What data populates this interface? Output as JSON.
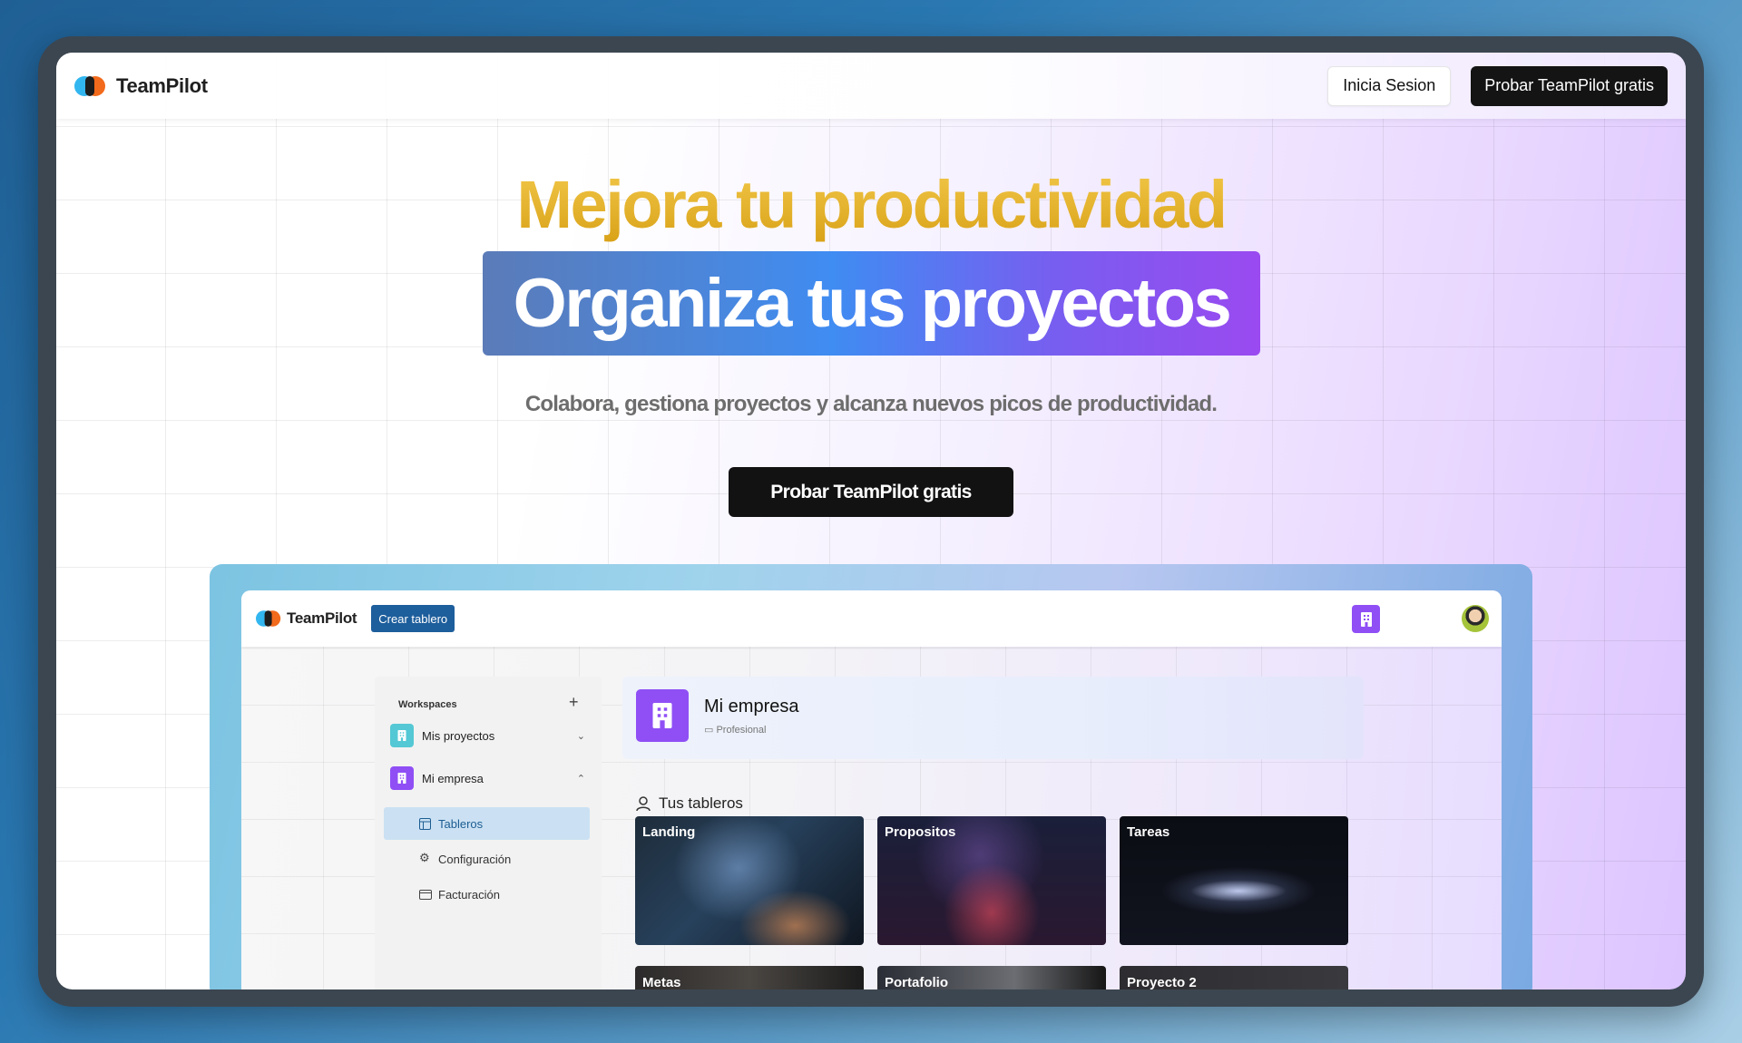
{
  "nav": {
    "brand": "TeamPilot",
    "login_label": "Inicia Sesion",
    "cta_label": "Probar TeamPilot gratis"
  },
  "hero": {
    "title": "Mejora tu productividad",
    "band": "Organiza tus proyectos",
    "subtitle": "Colabora, gestiona proyectos y alcanza nuevos picos de productividad.",
    "cta_label": "Probar TeamPilot gratis"
  },
  "app": {
    "brand": "TeamPilot",
    "create_board_label": "Crear tablero",
    "sidebar": {
      "heading": "Workspaces",
      "add_symbol": "+",
      "workspaces": [
        {
          "label": "Mis proyectos",
          "color": "#54c8d4",
          "expanded": false
        },
        {
          "label": "Mi empresa",
          "color": "#8f4ff5",
          "expanded": true
        }
      ],
      "sub_items": [
        {
          "label": "Tableros",
          "icon": "board-icon",
          "active": true
        },
        {
          "label": "Configuración",
          "icon": "gear-icon",
          "active": false
        },
        {
          "label": "Facturación",
          "icon": "card-icon",
          "active": false
        }
      ]
    },
    "workspace": {
      "name": "Mi empresa",
      "plan": "Profesional"
    },
    "boards_heading": "Tus tableros",
    "boards": [
      {
        "title": "Landing"
      },
      {
        "title": "Propositos"
      },
      {
        "title": "Tareas"
      },
      {
        "title": "Metas"
      },
      {
        "title": "Portafolio"
      },
      {
        "title": "Proyecto 2"
      }
    ]
  },
  "colors": {
    "accent_gold": "#dcaa1e",
    "accent_purple": "#8f4ff5",
    "accent_blue": "#1d5e9c",
    "dark_button": "#141414"
  }
}
